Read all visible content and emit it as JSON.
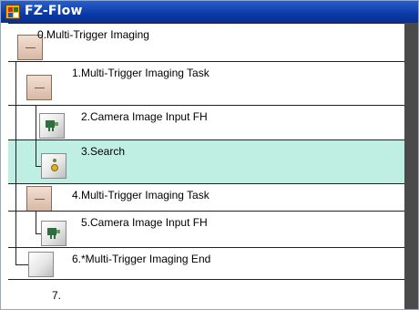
{
  "window": {
    "title": "FZ-Flow"
  },
  "flow": {
    "rows": [
      {
        "id": 0,
        "label": "0.Multi-Trigger Imaging",
        "icon": "task-icon"
      },
      {
        "id": 1,
        "label": "1.Multi-Trigger Imaging Task",
        "icon": "task-icon"
      },
      {
        "id": 2,
        "label": "2.Camera Image Input FH",
        "icon": "camera-icon"
      },
      {
        "id": 3,
        "label": "3.Search",
        "icon": "search-icon",
        "selected": true
      },
      {
        "id": 4,
        "label": "4.Multi-Trigger Imaging Task",
        "icon": "task-icon"
      },
      {
        "id": 5,
        "label": "5.Camera Image Input FH",
        "icon": "camera-icon"
      },
      {
        "id": 6,
        "label": "6.*Multi-Trigger Imaging End",
        "icon": "end-icon"
      },
      {
        "id": 7,
        "label": "7."
      }
    ],
    "selected_color": "#bfeee3"
  }
}
